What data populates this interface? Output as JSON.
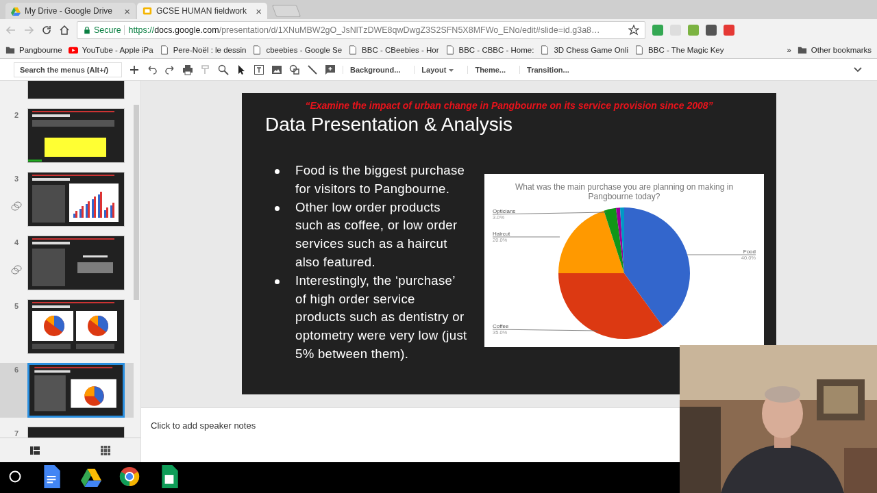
{
  "browser": {
    "tabs": [
      {
        "title": "My Drive - Google Drive",
        "kind": "drive",
        "selected": false,
        "close": "×"
      },
      {
        "title": "GCSE HUMAN fieldwork",
        "kind": "slides",
        "selected": true,
        "close": "×"
      }
    ],
    "address": {
      "secure_label": "Secure",
      "scheme": "https://",
      "host": "docs.google.com",
      "path": "/presentation/d/1XNuMBW2gO_JsNlTzDWE8qwDwgZ3S2SFN5X8MFWo_ENo/edit#slide=id.g3a8…"
    },
    "bookmarks": [
      {
        "label": "Pangbourne",
        "kind": "folder"
      },
      {
        "label": "YouTube - Apple iPa",
        "kind": "youtube"
      },
      {
        "label": "Pere-Noël : le dessin",
        "kind": "page"
      },
      {
        "label": "cbeebies - Google Se",
        "kind": "page"
      },
      {
        "label": "BBC - CBeebies - Hor",
        "kind": "page"
      },
      {
        "label": "BBC - CBBC - Home: ",
        "kind": "page"
      },
      {
        "label": "3D Chess Game Onli",
        "kind": "page"
      },
      {
        "label": "BBC - The Magic Key",
        "kind": "page"
      }
    ],
    "bookmarks_more": "»",
    "other_bookmarks": "Other bookmarks"
  },
  "toolbar": {
    "search_placeholder": "Search the menus (Alt+/)",
    "menus": [
      {
        "label": "Background..."
      },
      {
        "label": "Layout",
        "dropdown": true
      },
      {
        "label": "Theme..."
      },
      {
        "label": "Transition..."
      }
    ]
  },
  "thumbnails": [
    {
      "kind": "blank",
      "selected": false
    },
    {
      "number": "2",
      "kind": "table",
      "selected": false
    },
    {
      "number": "3",
      "kind": "bars",
      "selected": false,
      "linked": true
    },
    {
      "number": "4",
      "kind": "text",
      "selected": false,
      "linked": true
    },
    {
      "number": "5",
      "kind": "pies",
      "selected": false
    },
    {
      "number": "6",
      "kind": "pie",
      "selected": true
    },
    {
      "number": "7",
      "kind": "blank",
      "selected": false
    }
  ],
  "slide": {
    "question": "“Examine the impact of urban change in Pangbourne on its service provision since 2008”",
    "title": "Data Presentation & Analysis",
    "bullets": [
      "Food is the biggest purchase for visitors to Pangbourne.",
      "Other low order products such as coffee, or low order services such as a haircut also featured.",
      "Interestingly, the ‘purchase’ of high order service products such as dentistry or optometry were very low (just 5% between them)."
    ],
    "chart_data": {
      "type": "pie",
      "title": "What was the main purchase you are planning on making in Pangbourne today?",
      "categories": [
        "Food",
        "Coffee",
        "Haircut",
        "Opticians",
        null,
        null
      ],
      "series": [
        {
          "colors": [
            "#3366cc",
            "#dc3912",
            "#ff9900",
            "#109618",
            "#990099",
            "#0099c6"
          ],
          "values": [
            40,
            35,
            20,
            3,
            1,
            1
          ]
        }
      ],
      "value_labels": [
        "40.0%",
        "35.0%",
        "20.0%",
        "3.0%",
        null,
        null
      ]
    }
  },
  "speaker_notes": {
    "placeholder": "Click to add speaker notes"
  },
  "taskbar": {
    "apps": [
      {
        "kind": "launcher"
      },
      {
        "kind": "docs"
      },
      {
        "kind": "drive"
      },
      {
        "kind": "chrome"
      },
      {
        "kind": "sheets"
      }
    ]
  }
}
